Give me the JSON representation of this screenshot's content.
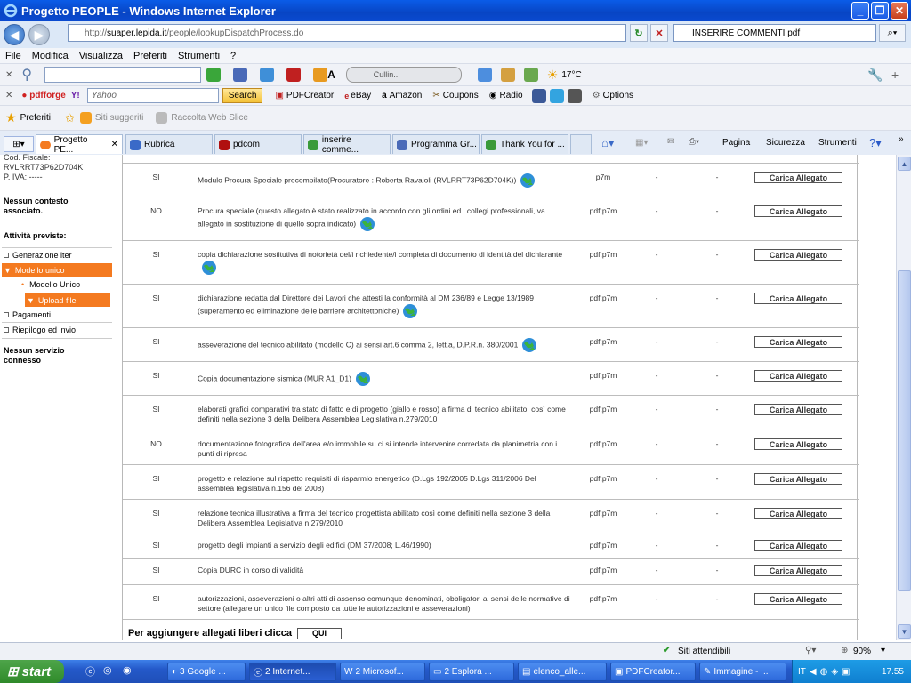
{
  "window": {
    "title": "Progetto PEOPLE - Windows Internet Explorer"
  },
  "address": {
    "protocol": "http://",
    "host": "suaper.lepida.it",
    "path": "/people/lookupDispatchProcess.do"
  },
  "search": {
    "value": "INSERIRE COMMENTI pdf"
  },
  "menu": [
    "File",
    "Modifica",
    "Visualizza",
    "Preferiti",
    "Strumenti",
    "?"
  ],
  "toolbar1": {
    "live_search": "Cullin...",
    "weather": "17°C"
  },
  "toolbar2": {
    "search_placeholder": "Yahoo",
    "search_button": "Search",
    "links": [
      "PDFCreator",
      "eBay",
      "Amazon",
      "Coupons",
      "Radio",
      "Options"
    ]
  },
  "favorites": {
    "preferiti": "Preferiti",
    "suggested": "Siti suggeriti",
    "webslice": "Raccolta Web Slice"
  },
  "tabs": [
    "Progetto PE...",
    "Rubrica",
    "pdcom",
    "inserire comme...",
    "Programma Gr...",
    "Thank You for ..."
  ],
  "cmdbar": [
    "Pagina",
    "Sicurezza",
    "Strumenti"
  ],
  "left": {
    "codfiscale_label": "Cod. Fiscale:",
    "codfiscale": "RVLRRT73P62D704K",
    "piva": "P. IVA: -----",
    "no_context": "Nessun contesto associato.",
    "activities": "Attività previste:",
    "items": [
      "Generazione iter",
      "Modello unico",
      "Modello Unico",
      "Upload file",
      "Pagamenti",
      "Riepilogo ed invio"
    ],
    "no_service": "Nessun servizio connesso"
  },
  "rows": [
    {
      "req": "SI",
      "desc": "Modulo Procura Speciale precompilato(Procuratore : Roberta Ravaioli (RVLRRT73P62D704K))",
      "fmt": "p7m",
      "d1": "-",
      "d2": "-",
      "btn": "Carica Allegato"
    },
    {
      "req": "NO",
      "desc": "Procura speciale (questo allegato è stato realizzato in accordo con gli ordini ed i collegi professionali, va allegato in sostituzione di quello sopra indicato)",
      "fmt": "pdf;p7m",
      "d1": "-",
      "d2": "-",
      "btn": "Carica Allegato"
    },
    {
      "req": "SI",
      "desc": "copia dichiarazione sostitutiva di notorietà del/i richiedente/i completa di documento di identità del dichiarante",
      "fmt": "pdf;p7m",
      "d1": "-",
      "d2": "-",
      "btn": "Carica Allegato"
    },
    {
      "req": "SI",
      "desc": "dichiarazione redatta dal Direttore dei Lavori che attesti la conformità al DM 236/89 e Legge 13/1989 (superamento ed eliminazione delle barriere architettoniche)",
      "fmt": "pdf;p7m",
      "d1": "-",
      "d2": "-",
      "btn": "Carica Allegato"
    },
    {
      "req": "SI",
      "desc": "asseverazione del tecnico abilitato (modello C) ai sensi art.6 comma 2, lett.a, D.P.R.n. 380/2001",
      "fmt": "pdf;p7m",
      "d1": "-",
      "d2": "-",
      "btn": "Carica Allegato"
    },
    {
      "req": "SI",
      "desc": "Copia documentazione sismica (MUR A1_D1)",
      "fmt": "pdf;p7m",
      "d1": "-",
      "d2": "-",
      "btn": "Carica Allegato"
    },
    {
      "req": "SI",
      "desc": "elaborati grafici comparativi tra stato di fatto e di progetto (giallo e rosso) a firma di tecnico abilitato, così come definiti nella sezione 3 della Delibera Assemblea Legislativa n.279/2010",
      "fmt": "pdf;p7m",
      "d1": "-",
      "d2": "-",
      "btn": "Carica Allegato"
    },
    {
      "req": "NO",
      "desc": "documentazione fotografica dell'area e/o immobile su ci si intende intervenire corredata da planimetria con i punti di ripresa",
      "fmt": "pdf;p7m",
      "d1": "-",
      "d2": "-",
      "btn": "Carica Allegato"
    },
    {
      "req": "SI",
      "desc": "progetto e relazione sul rispetto requisiti di risparmio energetico (D.Lgs 192/2005 D.Lgs 311/2006 Del assemblea legislativa n.156 del 2008)",
      "fmt": "pdf;p7m",
      "d1": "-",
      "d2": "-",
      "btn": "Carica Allegato"
    },
    {
      "req": "SI",
      "desc": "relazione tecnica illustrativa a firma del tecnico progettista abilitato così come definiti nella sezione 3 della Delibera Assemblea Legislativa n.279/2010",
      "fmt": "pdf;p7m",
      "d1": "-",
      "d2": "-",
      "btn": "Carica Allegato"
    },
    {
      "req": "SI",
      "desc": "progetto degli impianti a servizio degli edifici (DM 37/2008; L.46/1990)",
      "fmt": "pdf;p7m",
      "d1": "-",
      "d2": "-",
      "btn": "Carica Allegato"
    },
    {
      "req": "SI",
      "desc": "Copia DURC in corso di validità",
      "fmt": "pdf;p7m",
      "d1": "-",
      "d2": "-",
      "btn": "Carica Allegato"
    },
    {
      "req": "SI",
      "desc": "autorizzazioni, asseverazioni o altri atti di assenso comunque denominati, obbligatori ai sensi delle normative di settore (allegare un unico file composto da tutte le autorizzazioni e asseverazioni)",
      "fmt": "pdf;p7m",
      "d1": "-",
      "d2": "-",
      "btn": "Carica Allegato"
    }
  ],
  "footer": {
    "text": "Per aggiungere allegati liberi clicca",
    "button": "QUI"
  },
  "status": {
    "zone": "Siti attendibili",
    "zoom": "90%"
  },
  "taskbar": {
    "start": "start",
    "tasks": [
      "3 Google ...",
      "2 Internet...",
      "2 Microsof...",
      "2 Esplora ...",
      "elenco_alle...",
      "PDFCreator...",
      "Immagine - ..."
    ],
    "lang": "IT",
    "clock": "17.55"
  }
}
